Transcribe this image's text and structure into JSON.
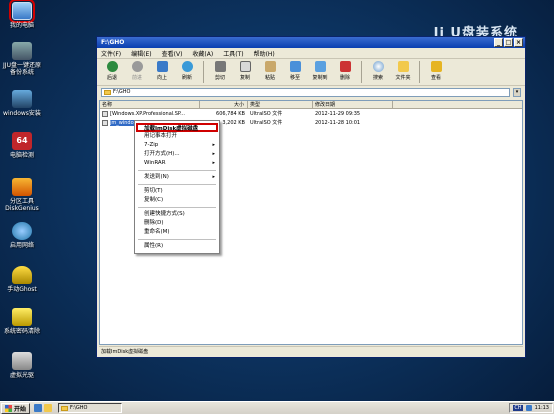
{
  "desktop": {
    "brand": "Jj U盘装系统",
    "icons": [
      {
        "label": "我的电脑",
        "icon": "computer-icon"
      },
      {
        "label": "JJU盘一键还原备份系统",
        "icon": "backup-icon"
      },
      {
        "label": "windows安装",
        "icon": "windows-install-icon"
      },
      {
        "label": "电脑检测",
        "icon": "pc-check-icon"
      },
      {
        "label": "分区工具DiskGenius",
        "icon": "diskgenius-icon"
      },
      {
        "label": "启用网络",
        "icon": "network-icon"
      },
      {
        "label": "手动Ghost",
        "icon": "ghost-icon"
      },
      {
        "label": "系统密码清除",
        "icon": "key-icon"
      },
      {
        "label": "虚拟光驱",
        "icon": "virtual-drive-icon"
      }
    ]
  },
  "window": {
    "title": "F:\\GHO",
    "menu": [
      "文件(F)",
      "编辑(E)",
      "查看(V)",
      "收藏(A)",
      "工具(T)",
      "帮助(H)"
    ],
    "toolbar": [
      "后退",
      "前进",
      "向上",
      "刷新",
      "剪切",
      "复制",
      "粘贴",
      "移至",
      "复制到",
      "删除",
      "搜索",
      "文件夹",
      "查看"
    ],
    "address": "F:\\GHO",
    "columns": [
      "名称",
      "大小",
      "类型",
      "修改日期"
    ],
    "files": [
      {
        "name": "[Windows.XP.Professional.SP...",
        "size": "606,784 KB",
        "type": "UltraISO 文件",
        "date": "2012-11-29 09:35"
      },
      {
        "name": "jm_windo",
        "size": "3,202 KB",
        "type": "UltraISO 文件",
        "date": "2012-11-28 10:01"
      }
    ],
    "status": "加载ImDisk虚拟磁盘"
  },
  "context_menu": {
    "items": [
      {
        "label": "加载ImDisk虚拟磁盘",
        "submenu": false
      },
      {
        "label": "用记事本打开",
        "submenu": false
      },
      {
        "label": "7-Zip",
        "submenu": true
      },
      {
        "label": "打开方式(H)...",
        "submenu": true
      },
      {
        "label": "WinRAR",
        "submenu": true
      },
      {
        "label": "发送到(N)",
        "submenu": true
      },
      {
        "label": "剪切(T)",
        "submenu": false
      },
      {
        "label": "复制(C)",
        "submenu": false
      },
      {
        "label": "创建快捷方式(S)",
        "submenu": false
      },
      {
        "label": "删除(D)",
        "submenu": false
      },
      {
        "label": "重命名(M)",
        "submenu": false
      },
      {
        "label": "属性(R)",
        "submenu": false
      }
    ]
  },
  "taskbar": {
    "start": "开始",
    "task": "F:\\GHO",
    "lang": "CH",
    "clock": "11:13"
  }
}
